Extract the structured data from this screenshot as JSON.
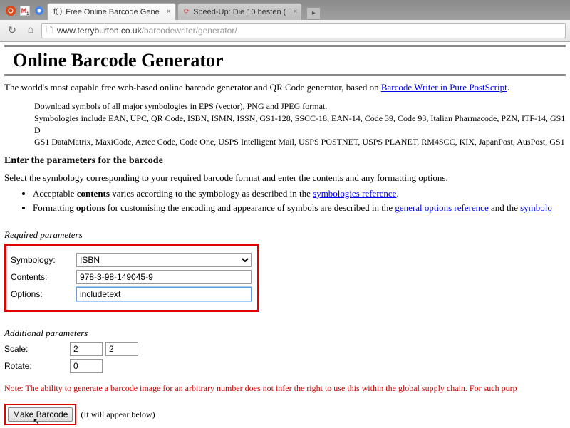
{
  "browser": {
    "tabs": [
      {
        "favicon": "f( )",
        "title": "Free Online Barcode Gene"
      },
      {
        "favicon": "⟳",
        "title": "Speed-Up: Die 10 besten ("
      }
    ],
    "url_host": "www.terryburton.co.uk",
    "url_path": "/barcodewriter/generator/"
  },
  "page": {
    "title": "Online Barcode Generator",
    "intro_prefix": "The world's most capable free web-based online barcode generator and QR Code generator, based on ",
    "intro_link": "Barcode Writer in Pure PostScript",
    "intro_suffix": ".",
    "blurb_line1": "Download symbols of all major symbologies in EPS (vector), PNG and JPEG format.",
    "blurb_line2": "Symbologies include EAN, UPC, QR Code, ISBN, ISMN, ISSN, GS1-128, SSCC-18, EAN-14, Code 39, Code 93, Italian Pharmacode, PZN, ITF-14, GS1 D",
    "blurb_line3": "GS1 DataMatrix, MaxiCode, Aztec Code, Code One, USPS Intelligent Mail, USPS POSTNET, USPS PLANET, RM4SCC, KIX, JapanPost, AusPost, GS1",
    "params_heading": "Enter the parameters for the barcode",
    "params_desc": "Select the symbology corresponding to your required barcode format and enter the contents and any formatting options.",
    "bullet1_a": "Acceptable ",
    "bullet1_b": "contents",
    "bullet1_c": " varies according to the symbology as described in the ",
    "bullet1_link": "symbologies reference",
    "bullet1_d": ".",
    "bullet2_a": "Formatting ",
    "bullet2_b": "options",
    "bullet2_c": " for customising the encoding and appearance of symbols are described in the ",
    "bullet2_link1": "general options reference",
    "bullet2_d": " and the ",
    "bullet2_link2": "symbolo",
    "required_label": "Required parameters",
    "additional_label": "Additional parameters",
    "labels": {
      "symbology": "Symbology:",
      "contents": "Contents:",
      "options": "Options:",
      "scale": "Scale:",
      "rotate": "Rotate:"
    },
    "values": {
      "symbology": "ISBN",
      "contents": "978-3-98-149045-9",
      "options": "includetext",
      "scale_x": "2",
      "scale_y": "2",
      "rotate": "0"
    },
    "note": "Note: The ability to generate a barcode image for an arbitrary number does not infer the right to use this within the global supply chain. For such purp",
    "make_button": "Make Barcode",
    "appear_text": "(It will appear below)"
  }
}
